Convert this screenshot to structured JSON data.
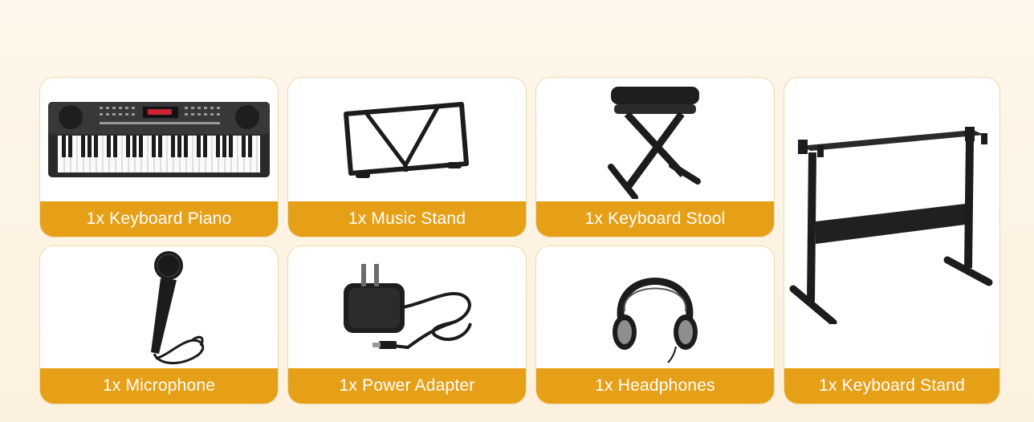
{
  "items": [
    {
      "label": "1x Keyboard Piano",
      "icon": "keyboard-piano-icon"
    },
    {
      "label": "1x Music Stand",
      "icon": "music-stand-icon"
    },
    {
      "label": "1x Keyboard Stool",
      "icon": "keyboard-stool-icon"
    },
    {
      "label": "1x Keyboard Stand",
      "icon": "keyboard-stand-icon"
    },
    {
      "label": "1x Microphone",
      "icon": "microphone-icon"
    },
    {
      "label": "1x Power Adapter",
      "icon": "power-adapter-icon"
    },
    {
      "label": "1x Headphones",
      "icon": "headphones-icon"
    }
  ],
  "colors": {
    "label_background": "#e6a018",
    "label_text": "#ffffff",
    "card_border": "#efd9ad",
    "page_background": "#fdf6ea"
  }
}
